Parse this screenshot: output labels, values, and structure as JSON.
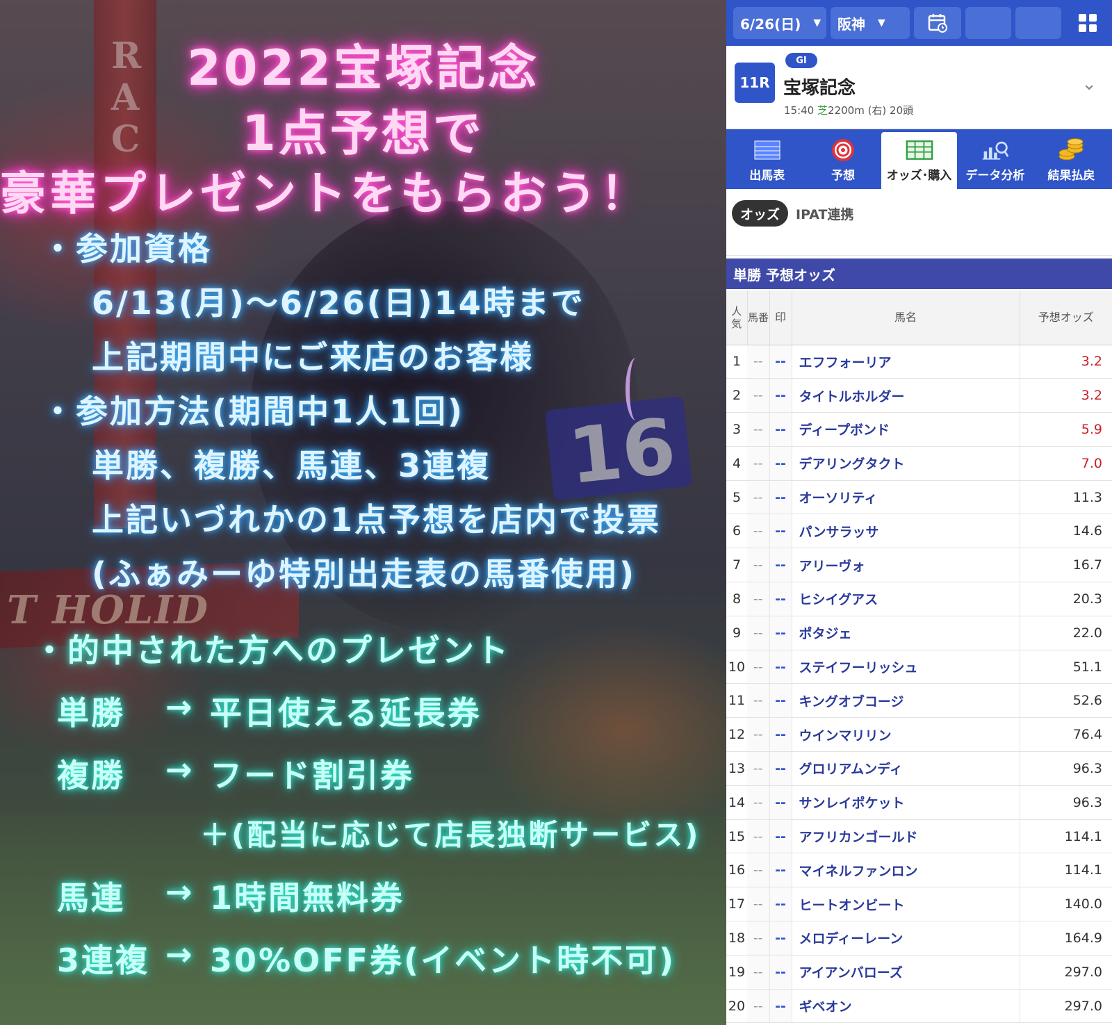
{
  "poster": {
    "title_line1": "2022宝塚記念",
    "title_line2": "1点予想で",
    "title_line3": "豪華プレゼントをもらおう！",
    "eligibility_head": "・参加資格",
    "eligibility_period": "6/13(月)～6/26(日)14時まで",
    "eligibility_who": "上記期間中にご来店のお客様",
    "method_head": "・参加方法(期間中1人1回)",
    "method_bets": "単勝、複勝、馬連、3連複",
    "method_vote": "上記いづれかの1点予想を店内で投票",
    "method_note": "(ふぁみーゆ特別出走表の馬番使用)",
    "prize_head": "・的中された方へのプレゼント",
    "prizes": [
      {
        "bet": "単勝",
        "arrow": "→",
        "prize": "平日使える延長券"
      },
      {
        "bet": "複勝",
        "arrow": "→",
        "prize": "フード割引券"
      },
      {
        "bet": "",
        "arrow": "",
        "prize": "＋(配当に応じて店長独断サービス)"
      },
      {
        "bet": "馬連",
        "arrow": "→",
        "prize": "1時間無料券"
      },
      {
        "bet": "3連複",
        "arrow": "→",
        "prize": "30%OFF券(イベント時不可)"
      }
    ],
    "bg_pole_letters": [
      "R",
      "A",
      "C"
    ],
    "bg_rail_text": "T HOLID",
    "bg_number_cloth": "16"
  },
  "app": {
    "topbar": {
      "date": "6/26(日)",
      "venue": "阪神",
      "caret": "▼"
    },
    "race": {
      "number": "11R",
      "grade": "GI",
      "name": "宝塚記念",
      "time": "15:40",
      "surface": "芝",
      "distance": "2200m (右) 20頭"
    },
    "tabs": [
      {
        "label": "出馬表",
        "icon": "list-icon"
      },
      {
        "label": "予想",
        "icon": "target-icon"
      },
      {
        "label": "オッズ･購入",
        "icon": "ipat-icon"
      },
      {
        "label": "データ分析",
        "icon": "chart-search-icon"
      },
      {
        "label": "結果払戻",
        "icon": "coins-icon"
      }
    ],
    "subtabs": {
      "active": "オッズ",
      "other": "IPAT連携"
    },
    "section_title": "単勝 予想オッズ",
    "table": {
      "headers": {
        "rank": "人気",
        "num": "馬番",
        "mark": "印",
        "name": "馬名",
        "odds": "予想オッズ"
      },
      "rows": [
        {
          "rank": "1",
          "num": "--",
          "mark": "--",
          "name": "エフフォーリア",
          "odds": "3.2",
          "hot": true
        },
        {
          "rank": "2",
          "num": "--",
          "mark": "--",
          "name": "タイトルホルダー",
          "odds": "3.2",
          "hot": true
        },
        {
          "rank": "3",
          "num": "--",
          "mark": "--",
          "name": "ディープボンド",
          "odds": "5.9",
          "hot": true
        },
        {
          "rank": "4",
          "num": "--",
          "mark": "--",
          "name": "デアリングタクト",
          "odds": "7.0",
          "hot": true
        },
        {
          "rank": "5",
          "num": "--",
          "mark": "--",
          "name": "オーソリティ",
          "odds": "11.3",
          "hot": false
        },
        {
          "rank": "6",
          "num": "--",
          "mark": "--",
          "name": "パンサラッサ",
          "odds": "14.6",
          "hot": false
        },
        {
          "rank": "7",
          "num": "--",
          "mark": "--",
          "name": "アリーヴォ",
          "odds": "16.7",
          "hot": false
        },
        {
          "rank": "8",
          "num": "--",
          "mark": "--",
          "name": "ヒシイグアス",
          "odds": "20.3",
          "hot": false
        },
        {
          "rank": "9",
          "num": "--",
          "mark": "--",
          "name": "ポタジェ",
          "odds": "22.0",
          "hot": false
        },
        {
          "rank": "10",
          "num": "--",
          "mark": "--",
          "name": "ステイフーリッシュ",
          "odds": "51.1",
          "hot": false
        },
        {
          "rank": "11",
          "num": "--",
          "mark": "--",
          "name": "キングオブコージ",
          "odds": "52.6",
          "hot": false
        },
        {
          "rank": "12",
          "num": "--",
          "mark": "--",
          "name": "ウインマリリン",
          "odds": "76.4",
          "hot": false
        },
        {
          "rank": "13",
          "num": "--",
          "mark": "--",
          "name": "グロリアムンディ",
          "odds": "96.3",
          "hot": false
        },
        {
          "rank": "14",
          "num": "--",
          "mark": "--",
          "name": "サンレイポケット",
          "odds": "96.3",
          "hot": false
        },
        {
          "rank": "15",
          "num": "--",
          "mark": "--",
          "name": "アフリカンゴールド",
          "odds": "114.1",
          "hot": false
        },
        {
          "rank": "16",
          "num": "--",
          "mark": "--",
          "name": "マイネルファンロン",
          "odds": "114.1",
          "hot": false
        },
        {
          "rank": "17",
          "num": "--",
          "mark": "--",
          "name": "ヒートオンビート",
          "odds": "140.0",
          "hot": false
        },
        {
          "rank": "18",
          "num": "--",
          "mark": "--",
          "name": "メロディーレーン",
          "odds": "164.9",
          "hot": false
        },
        {
          "rank": "19",
          "num": "--",
          "mark": "--",
          "name": "アイアンバローズ",
          "odds": "297.0",
          "hot": false
        },
        {
          "rank": "20",
          "num": "--",
          "mark": "--",
          "name": "ギベオン",
          "odds": "297.0",
          "hot": false
        }
      ]
    },
    "colors": {
      "brand_blue": "#2f55c9",
      "section_band": "#3f4aa8",
      "hot_odds": "#c8202a",
      "name_text": "#2a3a9a"
    }
  }
}
